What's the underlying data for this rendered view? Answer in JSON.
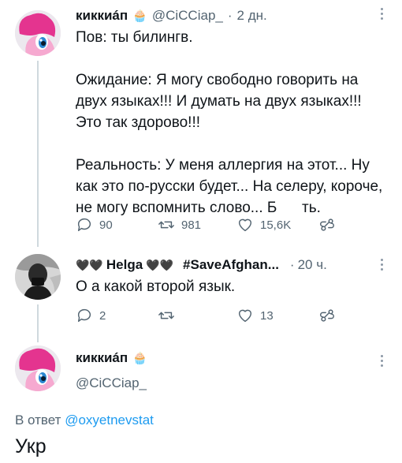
{
  "tweet1": {
    "name": "киккиáп",
    "handle": "@CiCCiap_",
    "sep": "·",
    "time": "2 дн.",
    "text": "Пов: ты билингв.\n\nОжидание: Я могу свободно говорить на двух языках!!! И думать на двух языках!!! Это так здорово!!!\n\nРеальность: У меня аллергия на этот... Ну как это по-русски будет... На селеру, короче, не могу вспомнить слово... Б      ть.",
    "replies": "90",
    "retweets": "981",
    "likes": "15,6K"
  },
  "tweet2": {
    "name_prefix": "🖤🖤",
    "name": "Helga",
    "name_suffix": "🖤🖤",
    "hashtag": "#SaveAfghan...",
    "sep": "·",
    "time": "20 ч.",
    "text": "О а какой второй язык.",
    "replies": "2",
    "retweets": "",
    "likes": "13"
  },
  "tweet3": {
    "name": "киккиáп",
    "handle": "@CiCCiap_",
    "reply_to_label": "В ответ",
    "reply_to_handle": "@oxyetnevstat",
    "text": "Укр"
  },
  "colors": {
    "link": "#1d9bf0",
    "muted": "#536471",
    "line": "#cfd9de",
    "pony_pink": "#f29ac7"
  },
  "icons": {
    "cupcake": "cupcake-emoji-icon",
    "reply": "reply-icon",
    "retweet": "retweet-icon",
    "like": "heart-icon",
    "share": "share-icon",
    "more": "more-dots-icon"
  }
}
